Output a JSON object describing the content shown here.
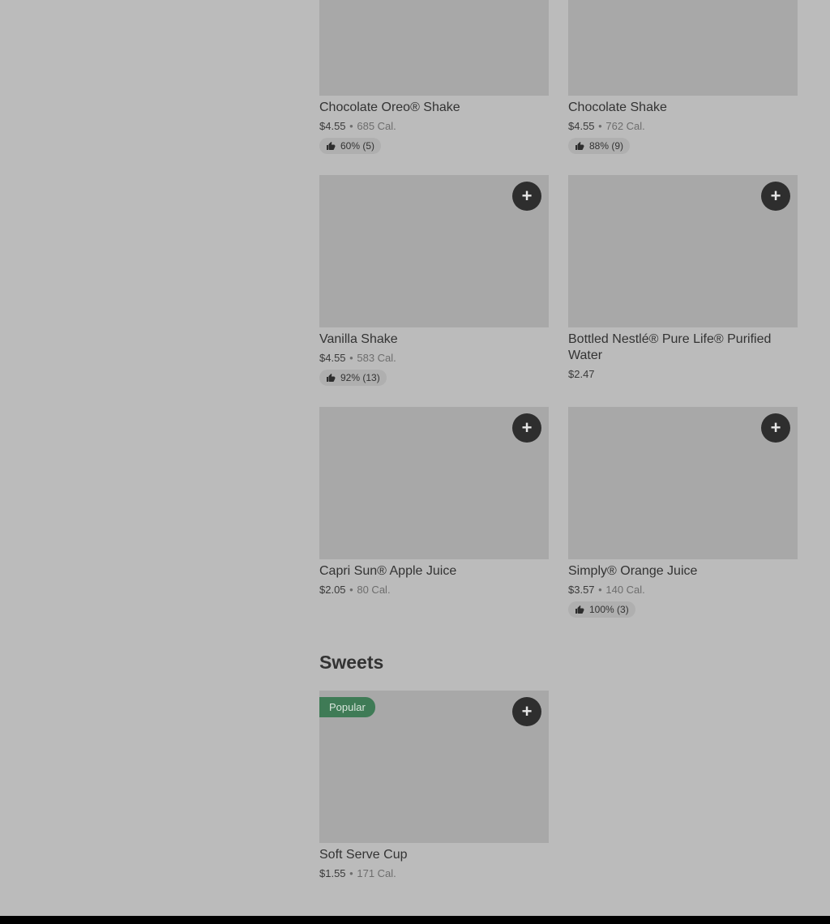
{
  "add_symbol": "+",
  "items": [
    {
      "name": "Chocolate Oreo® Shake",
      "price": "$4.55",
      "calories": "685 Cal.",
      "rating": "60% (5)"
    },
    {
      "name": "Chocolate Shake",
      "price": "$4.55",
      "calories": "762 Cal.",
      "rating": "88% (9)"
    },
    {
      "name": "Vanilla Shake",
      "price": "$4.55",
      "calories": "583 Cal.",
      "rating": "92% (13)"
    },
    {
      "name": "Bottled Nestlé® Pure Life® Purified Water",
      "price": "$2.47"
    },
    {
      "name": "Capri Sun® Apple Juice",
      "price": "$2.05",
      "calories": "80 Cal."
    },
    {
      "name": "Simply® Orange Juice",
      "price": "$3.57",
      "calories": "140 Cal.",
      "rating": "100% (3)"
    }
  ],
  "sweets": {
    "title": "Sweets",
    "items": [
      {
        "name": "Soft Serve Cup",
        "price": "$1.55",
        "calories": "171 Cal.",
        "badge": "Popular"
      }
    ]
  },
  "separator": "•",
  "colors": {
    "page_bg": "#bbbbbb",
    "image_placeholder": "#a8a8a8",
    "button_bg": "#2e2e2e",
    "popular_badge": "#3f7b56"
  },
  "icons": {
    "add": "plus-icon",
    "rating": "thumbs-up-icon"
  }
}
